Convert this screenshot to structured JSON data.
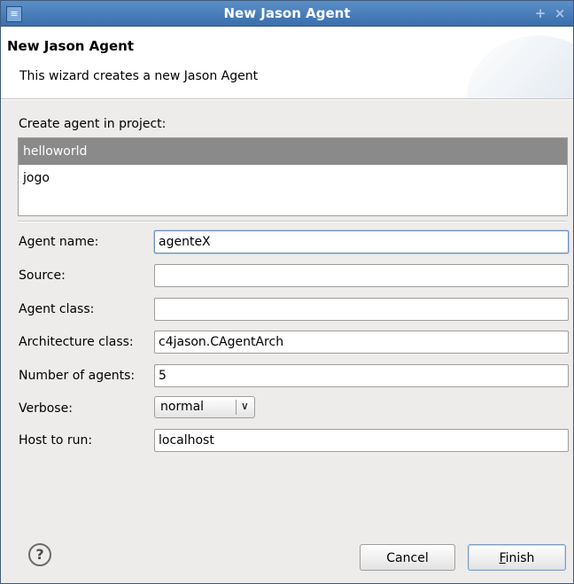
{
  "window": {
    "title": "New Jason Agent"
  },
  "header": {
    "title": "New Jason Agent",
    "description": "This wizard creates a new Jason Agent"
  },
  "project": {
    "label": "Create agent in project:",
    "items": [
      {
        "label": "helloworld",
        "selected": true
      },
      {
        "label": "jogo",
        "selected": false
      }
    ]
  },
  "form": {
    "agent_name": {
      "label": "Agent name:",
      "value": "agenteX"
    },
    "source": {
      "label": "Source:",
      "value": ""
    },
    "agent_class": {
      "label": "Agent class:",
      "value": ""
    },
    "architecture_class": {
      "label": "Architecture class:",
      "value": "c4jason.CAgentArch"
    },
    "number_of_agents": {
      "label": "Number of agents:",
      "value": "5"
    },
    "verbose": {
      "label": "Verbose:",
      "value": "normal"
    },
    "host_to_run": {
      "label": "Host to run:",
      "value": "localhost"
    }
  },
  "buttons": {
    "help_glyph": "?",
    "cancel": "Cancel",
    "finish_mnemonic": "F",
    "finish_rest": "inish"
  },
  "icons": {
    "help": "help-icon",
    "app": "eclipse-icon",
    "maximize": "maximize-icon",
    "close": "close-icon"
  },
  "colors": {
    "titlebar": "#3a6fad",
    "selection": "#8a8a8a"
  }
}
